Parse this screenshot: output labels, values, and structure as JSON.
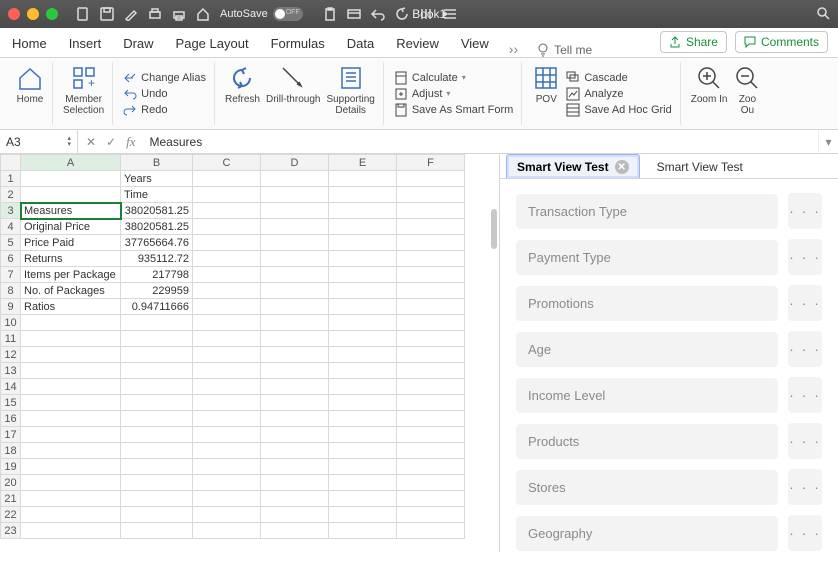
{
  "titlebar": {
    "autosave_label": "AutoSave",
    "doc_title": "Book1"
  },
  "tabs": [
    "Home",
    "Insert",
    "Draw",
    "Page Layout",
    "Formulas",
    "Data",
    "Review",
    "View"
  ],
  "tellme": "Tell me",
  "share": "Share",
  "comments": "Comments",
  "ribbon": {
    "home": "Home",
    "member_selection": "Member\nSelection",
    "change_alias": "Change Alias",
    "undo": "Undo",
    "redo": "Redo",
    "refresh": "Refresh",
    "drill": "Drill-through",
    "details": "Supporting\nDetails",
    "calculate": "Calculate",
    "adjust": "Adjust",
    "save_smart": "Save As Smart Form",
    "pov": "POV",
    "cascade": "Cascade",
    "analyze": "Analyze",
    "save_adhoc": "Save Ad Hoc Grid",
    "zoom_in": "Zoom In",
    "zoom_out": "Zoo\nOu"
  },
  "formula_bar": {
    "cell_ref": "A3",
    "value": "Measures"
  },
  "sheet": {
    "columns": [
      "A",
      "B",
      "C",
      "D",
      "E",
      "F"
    ],
    "row_count": 23,
    "cells": {
      "B1": "Years",
      "B2": "Time",
      "A3": "Measures",
      "B3": "38020581.25",
      "A4": "Original Price",
      "B4": "38020581.25",
      "A5": "Price Paid",
      "B5": "37765664.76",
      "A6": "Returns",
      "B6": "935112.72",
      "A7": "Items per Package",
      "B7": "217798",
      "A8": "No. of Packages",
      "B8": "229959",
      "A9": "Ratios",
      "B9": "0.94711666"
    },
    "selected": "A3"
  },
  "panel": {
    "tab1": "Smart View Test",
    "tab2": "Smart View Test",
    "fields": [
      "Transaction Type",
      "Payment Type",
      "Promotions",
      "Age",
      "Income Level",
      "Products",
      "Stores",
      "Geography"
    ],
    "dots": "· · ·"
  }
}
